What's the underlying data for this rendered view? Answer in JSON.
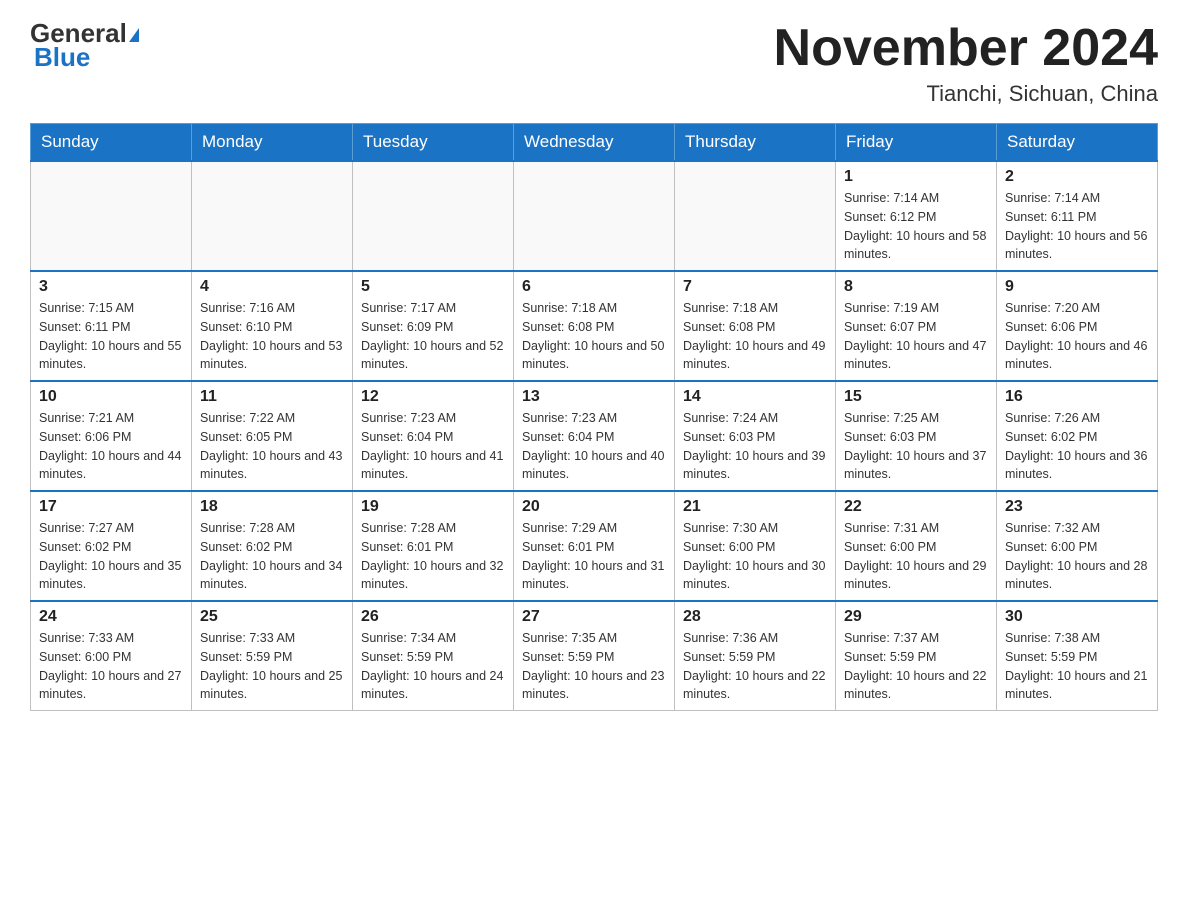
{
  "header": {
    "logo_line1": "General",
    "logo_line2": "Blue",
    "month_title": "November 2024",
    "location": "Tianchi, Sichuan, China"
  },
  "weekdays": [
    "Sunday",
    "Monday",
    "Tuesday",
    "Wednesday",
    "Thursday",
    "Friday",
    "Saturday"
  ],
  "weeks": [
    [
      {
        "day": "",
        "info": ""
      },
      {
        "day": "",
        "info": ""
      },
      {
        "day": "",
        "info": ""
      },
      {
        "day": "",
        "info": ""
      },
      {
        "day": "",
        "info": ""
      },
      {
        "day": "1",
        "info": "Sunrise: 7:14 AM\nSunset: 6:12 PM\nDaylight: 10 hours and 58 minutes."
      },
      {
        "day": "2",
        "info": "Sunrise: 7:14 AM\nSunset: 6:11 PM\nDaylight: 10 hours and 56 minutes."
      }
    ],
    [
      {
        "day": "3",
        "info": "Sunrise: 7:15 AM\nSunset: 6:11 PM\nDaylight: 10 hours and 55 minutes."
      },
      {
        "day": "4",
        "info": "Sunrise: 7:16 AM\nSunset: 6:10 PM\nDaylight: 10 hours and 53 minutes."
      },
      {
        "day": "5",
        "info": "Sunrise: 7:17 AM\nSunset: 6:09 PM\nDaylight: 10 hours and 52 minutes."
      },
      {
        "day": "6",
        "info": "Sunrise: 7:18 AM\nSunset: 6:08 PM\nDaylight: 10 hours and 50 minutes."
      },
      {
        "day": "7",
        "info": "Sunrise: 7:18 AM\nSunset: 6:08 PM\nDaylight: 10 hours and 49 minutes."
      },
      {
        "day": "8",
        "info": "Sunrise: 7:19 AM\nSunset: 6:07 PM\nDaylight: 10 hours and 47 minutes."
      },
      {
        "day": "9",
        "info": "Sunrise: 7:20 AM\nSunset: 6:06 PM\nDaylight: 10 hours and 46 minutes."
      }
    ],
    [
      {
        "day": "10",
        "info": "Sunrise: 7:21 AM\nSunset: 6:06 PM\nDaylight: 10 hours and 44 minutes."
      },
      {
        "day": "11",
        "info": "Sunrise: 7:22 AM\nSunset: 6:05 PM\nDaylight: 10 hours and 43 minutes."
      },
      {
        "day": "12",
        "info": "Sunrise: 7:23 AM\nSunset: 6:04 PM\nDaylight: 10 hours and 41 minutes."
      },
      {
        "day": "13",
        "info": "Sunrise: 7:23 AM\nSunset: 6:04 PM\nDaylight: 10 hours and 40 minutes."
      },
      {
        "day": "14",
        "info": "Sunrise: 7:24 AM\nSunset: 6:03 PM\nDaylight: 10 hours and 39 minutes."
      },
      {
        "day": "15",
        "info": "Sunrise: 7:25 AM\nSunset: 6:03 PM\nDaylight: 10 hours and 37 minutes."
      },
      {
        "day": "16",
        "info": "Sunrise: 7:26 AM\nSunset: 6:02 PM\nDaylight: 10 hours and 36 minutes."
      }
    ],
    [
      {
        "day": "17",
        "info": "Sunrise: 7:27 AM\nSunset: 6:02 PM\nDaylight: 10 hours and 35 minutes."
      },
      {
        "day": "18",
        "info": "Sunrise: 7:28 AM\nSunset: 6:02 PM\nDaylight: 10 hours and 34 minutes."
      },
      {
        "day": "19",
        "info": "Sunrise: 7:28 AM\nSunset: 6:01 PM\nDaylight: 10 hours and 32 minutes."
      },
      {
        "day": "20",
        "info": "Sunrise: 7:29 AM\nSunset: 6:01 PM\nDaylight: 10 hours and 31 minutes."
      },
      {
        "day": "21",
        "info": "Sunrise: 7:30 AM\nSunset: 6:00 PM\nDaylight: 10 hours and 30 minutes."
      },
      {
        "day": "22",
        "info": "Sunrise: 7:31 AM\nSunset: 6:00 PM\nDaylight: 10 hours and 29 minutes."
      },
      {
        "day": "23",
        "info": "Sunrise: 7:32 AM\nSunset: 6:00 PM\nDaylight: 10 hours and 28 minutes."
      }
    ],
    [
      {
        "day": "24",
        "info": "Sunrise: 7:33 AM\nSunset: 6:00 PM\nDaylight: 10 hours and 27 minutes."
      },
      {
        "day": "25",
        "info": "Sunrise: 7:33 AM\nSunset: 5:59 PM\nDaylight: 10 hours and 25 minutes."
      },
      {
        "day": "26",
        "info": "Sunrise: 7:34 AM\nSunset: 5:59 PM\nDaylight: 10 hours and 24 minutes."
      },
      {
        "day": "27",
        "info": "Sunrise: 7:35 AM\nSunset: 5:59 PM\nDaylight: 10 hours and 23 minutes."
      },
      {
        "day": "28",
        "info": "Sunrise: 7:36 AM\nSunset: 5:59 PM\nDaylight: 10 hours and 22 minutes."
      },
      {
        "day": "29",
        "info": "Sunrise: 7:37 AM\nSunset: 5:59 PM\nDaylight: 10 hours and 22 minutes."
      },
      {
        "day": "30",
        "info": "Sunrise: 7:38 AM\nSunset: 5:59 PM\nDaylight: 10 hours and 21 minutes."
      }
    ]
  ]
}
